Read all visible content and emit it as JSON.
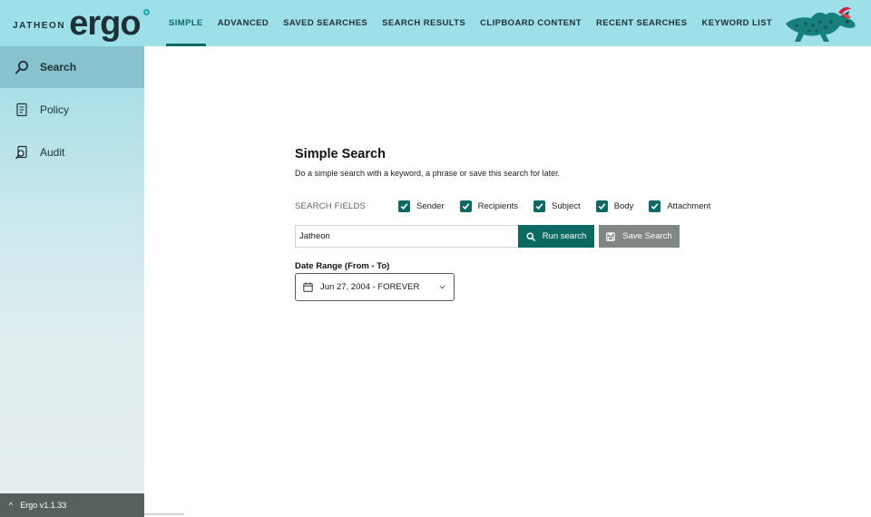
{
  "app": {
    "brand_small": "JATHEON",
    "brand_big": "ergo",
    "version": "Ergo v1.1.33"
  },
  "nav": {
    "tabs": [
      {
        "label": "SIMPLE",
        "active": true
      },
      {
        "label": "ADVANCED",
        "active": false
      },
      {
        "label": "SAVED SEARCHES",
        "active": false
      },
      {
        "label": "SEARCH RESULTS",
        "active": false
      },
      {
        "label": "CLIPBOARD CONTENT",
        "active": false
      },
      {
        "label": "RECENT SEARCHES",
        "active": false
      },
      {
        "label": "KEYWORD LIST",
        "active": false
      }
    ]
  },
  "sidebar": {
    "items": [
      {
        "label": "Search",
        "icon": "search-icon",
        "active": true
      },
      {
        "label": "Policy",
        "icon": "policy-icon",
        "active": false
      },
      {
        "label": "Audit",
        "icon": "audit-icon",
        "active": false
      }
    ]
  },
  "main": {
    "title": "Simple Search",
    "subtitle": "Do a simple search with a keyword, a phrase or save this search for later.",
    "fields_label": "SEARCH FIELDS",
    "fields": [
      {
        "label": "Sender",
        "checked": true
      },
      {
        "label": "Recipients",
        "checked": true
      },
      {
        "label": "Subject",
        "checked": true
      },
      {
        "label": "Body",
        "checked": true
      },
      {
        "label": "Attachment",
        "checked": true
      }
    ],
    "search_value": "Jatheon",
    "run_label": "Run search",
    "save_label": "Save Search",
    "date_label": "Date Range (From - To)",
    "date_value": "Jun 27, 2004 - FOREVER"
  },
  "colors": {
    "accent": "#0b6b63",
    "topbar": "#9ee0e8",
    "sidebar_active": "#86c3cc",
    "save_button": "#808586",
    "footer": "#58605f"
  }
}
